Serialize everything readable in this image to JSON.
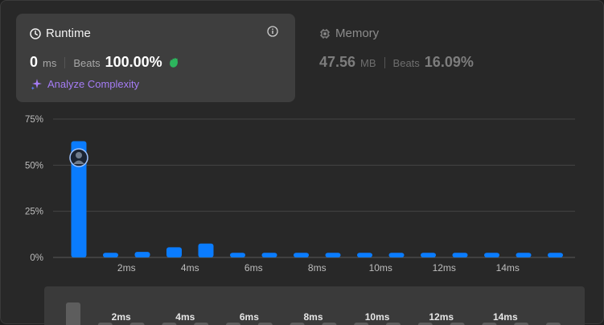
{
  "runtime": {
    "title": "Runtime",
    "value": "0",
    "unit": "ms",
    "beats_label": "Beats",
    "beats_value": "100.00%",
    "analyze_label": "Analyze Complexity"
  },
  "memory": {
    "title": "Memory",
    "value": "47.56",
    "unit": "MB",
    "beats_label": "Beats",
    "beats_value": "16.09%"
  },
  "colors": {
    "bar": "#0a7cff",
    "beats_runtime": "#ffffff",
    "accent_purple": "#a57cf5",
    "clap": "#2db55d"
  },
  "chart_data": {
    "type": "bar",
    "ylim": [
      0,
      75
    ],
    "y_ticks": [
      "0%",
      "25%",
      "50%",
      "75%"
    ],
    "y_tick_values": [
      0,
      25,
      50,
      75
    ],
    "x_ticks": [
      "2ms",
      "4ms",
      "6ms",
      "8ms",
      "10ms",
      "12ms",
      "14ms"
    ],
    "values": [
      63,
      2.5,
      3,
      5.5,
      7.5,
      2.5,
      2.5,
      2.5,
      2.5,
      2.5,
      2.5,
      2.5,
      2.5,
      2.5,
      2.5,
      2.5
    ],
    "highlight_index": 0
  },
  "mini_chart": {
    "x_ticks": [
      "2ms",
      "4ms",
      "6ms",
      "8ms",
      "10ms",
      "12ms",
      "14ms"
    ]
  }
}
